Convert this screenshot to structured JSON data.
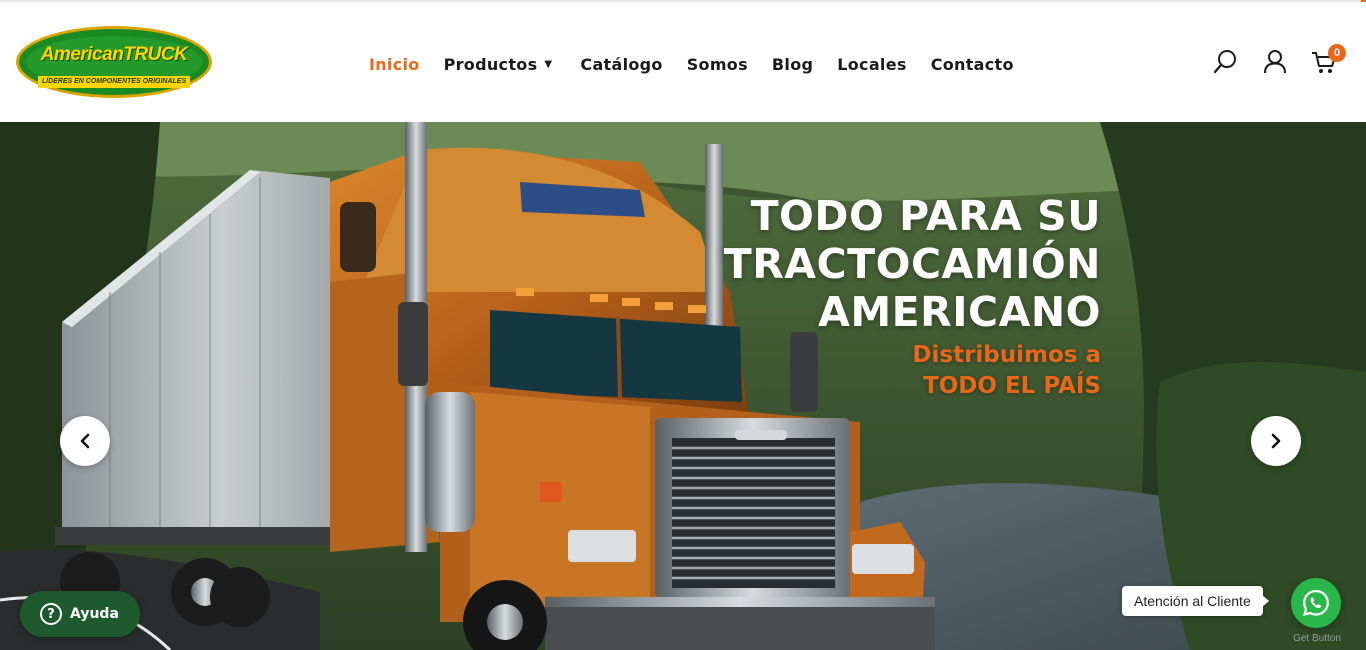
{
  "logo": {
    "brand": "AmericanTRUCK",
    "tagline": "LÍDERES EN COMPONENTES ORIGINALES"
  },
  "nav": {
    "items": [
      {
        "label": "Inicio",
        "active": true
      },
      {
        "label": "Productos",
        "has_dropdown": true
      },
      {
        "label": "Catálogo"
      },
      {
        "label": "Somos"
      },
      {
        "label": "Blog"
      },
      {
        "label": "Locales"
      },
      {
        "label": "Contacto"
      }
    ]
  },
  "header_icons": {
    "search": "search-icon",
    "account": "user-icon",
    "cart": "cart-icon",
    "cart_count": "0"
  },
  "hero": {
    "headline": [
      "TODO PARA SU",
      "TRACTOCAMIÓN",
      "AMERICANO"
    ],
    "subline": [
      "Distribuimos a",
      "TODO EL PAÍS"
    ],
    "prev_icon": "chevron-left-icon",
    "next_icon": "chevron-right-icon"
  },
  "widgets": {
    "help_label": "Ayuda",
    "whatsapp_label": "Atención al Cliente",
    "whatsapp_caption": "Get Button"
  },
  "colors": {
    "accent": "#e8671a",
    "whatsapp": "#29b64b",
    "help": "#1f5a2e",
    "logo_green": "#1c8a22",
    "logo_yellow": "#ffd400"
  }
}
